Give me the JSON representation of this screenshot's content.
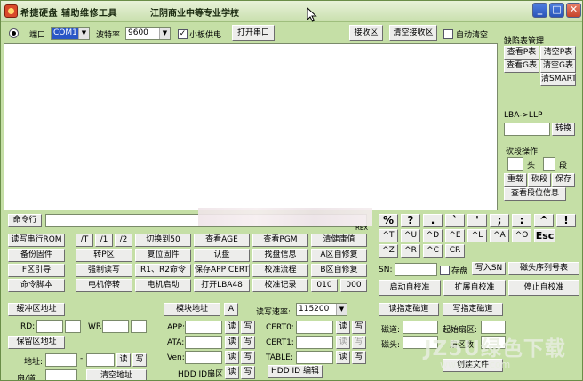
{
  "window": {
    "title": "希捷硬盘 辅助维修工具",
    "school": "江阴商业中等专业学校",
    "minimize": "_",
    "maximize": "□",
    "close": "✕"
  },
  "serial": {
    "port_label": "端口",
    "port_value": "COM1",
    "baud_label": "波特率",
    "baud_value": "9600",
    "power_label": "小板供电",
    "open_port": "打开串口",
    "receive_area": "接收区",
    "clear_receive": "清空接收区",
    "auto_clear": "自动清空"
  },
  "defect_panel": {
    "title": "缺陷表管理",
    "view_p": "查看P表",
    "clear_p": "清空P表",
    "view_g": "查看G表",
    "clear_g": "清空G表",
    "clear_smart": "清SMART",
    "lba_title": "LBA->LLP",
    "convert": "转换",
    "seg_title": "砍段操作",
    "head_label": "头",
    "seg_label": "段",
    "reload": "重载",
    "cut": "砍段",
    "save": "保存",
    "view_seg": "查看段位信息"
  },
  "command": {
    "label": "命令行",
    "rex": "REX"
  },
  "button_rows": [
    [
      "读写串行ROM",
      "/T",
      "/1",
      "/2",
      "切换到50",
      "查看AGE",
      "查看PGM",
      "清健康值"
    ],
    [
      "备份固件",
      "转P区",
      "复位固件",
      "认盘",
      "找盘信息",
      "A区自修复"
    ],
    [
      "F区引导",
      "强制读写",
      "R1、R2命令",
      "保存APP CERT",
      "校准流程",
      "B区自修复"
    ],
    [
      "命令脚本",
      "电机停转",
      "电机启动",
      "打开LBA48",
      "校准记录",
      "010",
      "000"
    ]
  ],
  "keypad": [
    [
      "%",
      "?",
      ".",
      "`",
      "'",
      ";",
      ":",
      "^",
      "!"
    ],
    [
      "^T",
      "^U",
      "^D",
      "^E",
      "^L",
      "^A",
      "^O",
      "Esc"
    ],
    [
      "^Z",
      "^R",
      "^C",
      "CR"
    ]
  ],
  "sn": {
    "label": "SN:",
    "save_label": "存盘",
    "write_sn": "写入SN",
    "head_sn": "磁头序列号表"
  },
  "calib": {
    "start": "启动自校准",
    "extended": "扩展自校准",
    "stop": "停止自校准"
  },
  "buffer": {
    "buffer_addr": "缓冲区地址",
    "rd_label": "RD:",
    "wr_label": "WR:",
    "reserve_addr": "保留区地址",
    "addr_label": "地址:",
    "addr_sep": "-",
    "read": "读",
    "write": "写",
    "fan_track": "扇/道",
    "clear_addr": "清空地址"
  },
  "module": {
    "module_addr": "模块地址",
    "a": "A",
    "app": "APP:",
    "ata": "ATA:",
    "ven": "Ven:",
    "read": "读",
    "write": "写",
    "hdd_sector": "HDD ID扇区"
  },
  "rw_rate": {
    "label": "读写速率:",
    "value": "115200",
    "cert0": "CERT0:",
    "cert1": "CERT1:",
    "table": "TABLE:",
    "read": "读",
    "write": "写",
    "hdd_edit": "HDD ID 编辑"
  },
  "track": {
    "read_track": "读指定磁道",
    "write_track": "写指定磁道",
    "track_label": "磁道:",
    "start_sector": "起始扇区:",
    "head_label": "磁头:",
    "sector_count": "扇区数:",
    "create_file": "创建文件"
  }
}
